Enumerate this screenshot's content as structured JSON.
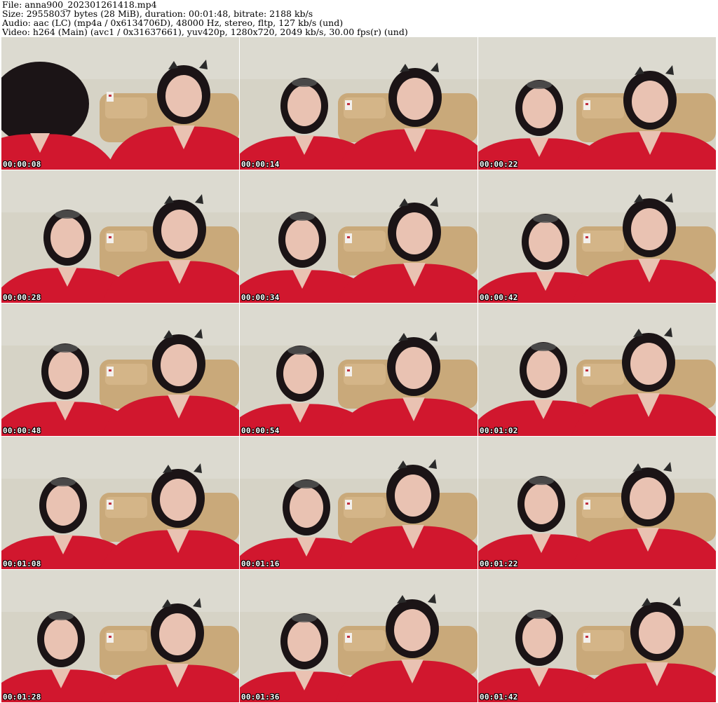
{
  "header": {
    "file_line": "File: anna900_202301261418.mp4",
    "size_line": "Size: 29558037 bytes (28 MiB), duration: 00:01:48, bitrate: 2188 kb/s",
    "audio_line": "Audio: aac (LC) (mp4a / 0x6134706D), 48000 Hz, stereo, fltp, 127 kb/s (und)",
    "video_line": "Video: h264 (Main) (avc1 / 0x31637661), yuv420p, 1280x720, 2049 kb/s, 30.00 fps(r) (und)"
  },
  "thumbnails": [
    {
      "timestamp": "00:00:08"
    },
    {
      "timestamp": "00:00:14"
    },
    {
      "timestamp": "00:00:22"
    },
    {
      "timestamp": "00:00:28"
    },
    {
      "timestamp": "00:00:34"
    },
    {
      "timestamp": "00:00:42"
    },
    {
      "timestamp": "00:00:48"
    },
    {
      "timestamp": "00:00:54"
    },
    {
      "timestamp": "00:01:02"
    },
    {
      "timestamp": "00:01:08"
    },
    {
      "timestamp": "00:01:16"
    },
    {
      "timestamp": "00:01:22"
    },
    {
      "timestamp": "00:01:28"
    },
    {
      "timestamp": "00:01:36"
    },
    {
      "timestamp": "00:01:42"
    }
  ],
  "colors": {
    "wall": "#d6d3c6",
    "sofa": "#c9a97a",
    "clothing": "#d1172e",
    "hair": "#1b1416",
    "skin": "#e9c2b2"
  }
}
